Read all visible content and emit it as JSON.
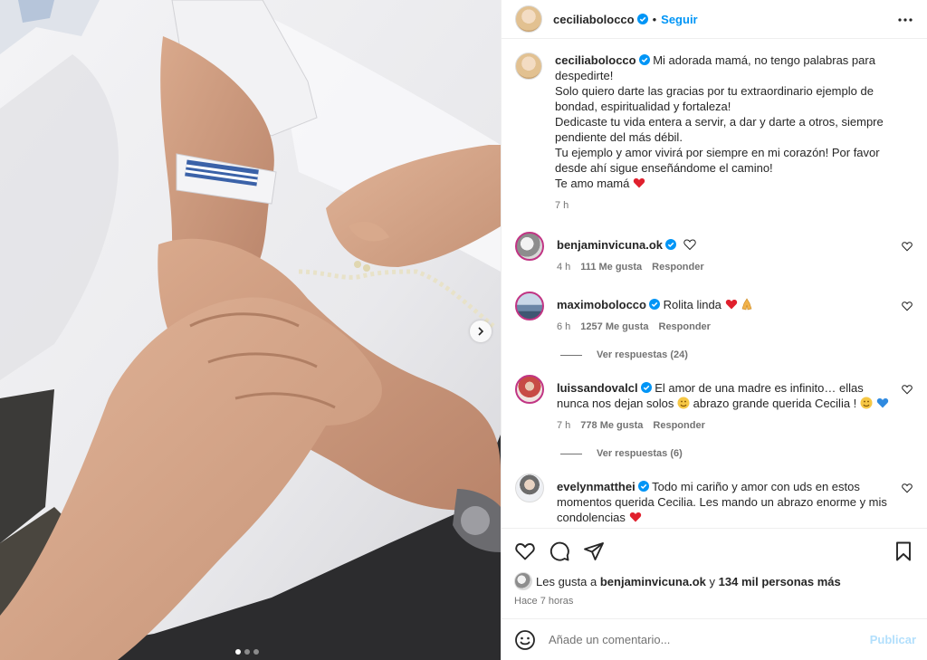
{
  "post": {
    "author": "ceciliabolocco",
    "follow_label": "Seguir",
    "bullet": "•",
    "more_icon": "more-horizontal-icon",
    "caption_lines": [
      "Mi adorada mamá, no tengo palabras para despedirte!",
      "Solo quiero darte las gracias por tu extraordinario ejemplo de bondad, espiritualidad y fortaleza!",
      "Dedicaste tu vida entera a servir, a dar y darte a otros, siempre pendiente del más débil.",
      "Tu ejemplo y amor vivirá por siempre en mi corazón! Por favor desde ahí sigue enseñándome el camino!",
      "Te amo mamá"
    ],
    "caption_time": "7 h"
  },
  "comments": [
    {
      "user": "benjaminvicuna.ok",
      "text": "",
      "time": "4 h",
      "likes": "111 Me gusta",
      "reply": "Responder",
      "emoji": "white-heart"
    },
    {
      "user": "maximobolocco",
      "text": "Rolita linda",
      "time": "6 h",
      "likes": "1257 Me gusta",
      "reply": "Responder",
      "emoji": "red-heart-pray",
      "view_replies": "Ver respuestas (24)"
    },
    {
      "user": "luissandovalcl",
      "text": "El amor de una madre es infinito… ellas nunca nos dejan solos",
      "text2": "abrazo grande querida Cecilia !",
      "time": "7 h",
      "likes": "778 Me gusta",
      "reply": "Responder",
      "view_replies": "Ver respuestas (6)"
    },
    {
      "user": "evelynmatthei",
      "text": "Todo mi cariño y amor con uds en estos momentos querida Cecilia. Les mando un abrazo enorme y mis condolencias",
      "emoji": "red-heart"
    }
  ],
  "footer": {
    "likes_prefix": "Les gusta a",
    "likes_user": "benjaminvicuna.ok",
    "likes_mid": "y",
    "likes_rest": "134 mil personas más",
    "time": "Hace 7 horas",
    "comment_placeholder": "Añade un comentario...",
    "publish_label": "Publicar"
  },
  "carousel": {
    "slide_count": 3,
    "active_index": 0
  },
  "colors": {
    "accent": "#0095f6",
    "verified": "#0095f6",
    "heart": "#ed4956",
    "muted": "#737373"
  }
}
